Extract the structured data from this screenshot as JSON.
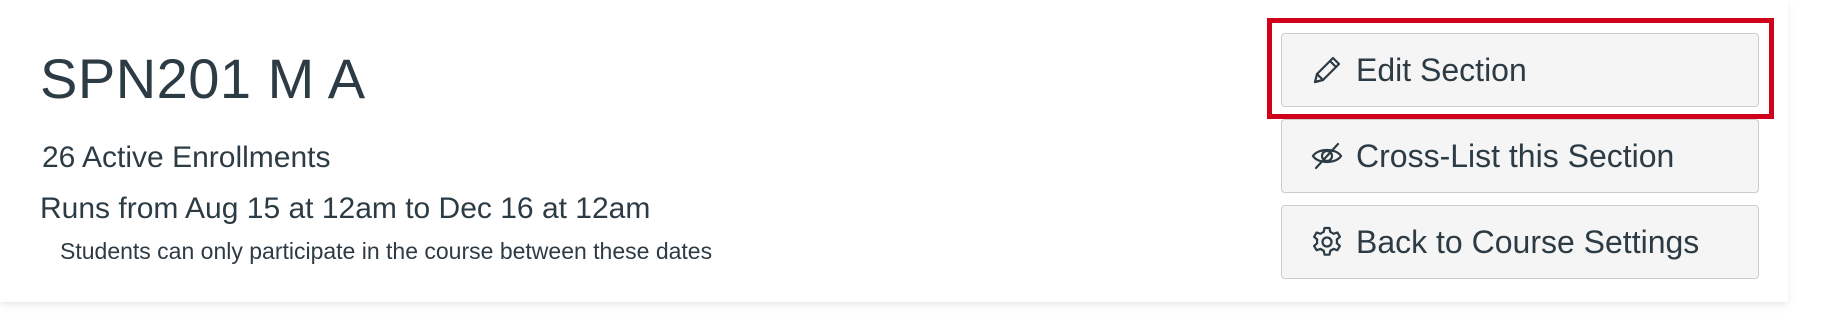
{
  "section": {
    "title": "SPN201 M A",
    "enrollments": "26 Active Enrollments",
    "run_dates": "Runs from Aug 15 at 12am to Dec 16 at 12am",
    "date_note": "Students can only participate in the course between these dates"
  },
  "actions": {
    "edit_label": "Edit Section",
    "crosslist_label": "Cross-List this Section",
    "back_label": "Back to Course Settings"
  },
  "icons": {
    "edit": "pencil-icon",
    "crosslist": "eye-slash-icon",
    "back": "gear-icon"
  },
  "colors": {
    "text": "#2d3b45",
    "button_bg": "#f5f5f5",
    "button_border": "#c7cdd1",
    "highlight": "#d0021b"
  }
}
